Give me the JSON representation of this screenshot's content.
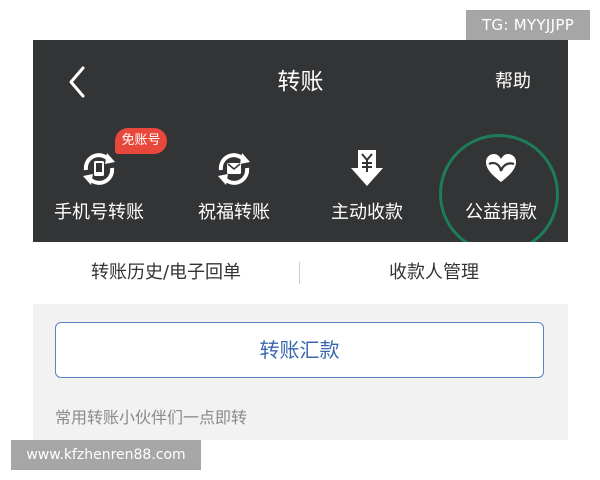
{
  "watermarks": {
    "top": "TG: MYYJJPP",
    "bottom": "www.kfzhenren88.com"
  },
  "header": {
    "title": "转账",
    "back_icon": "chevron-left-icon",
    "help_label": "帮助",
    "background_color": "#333436"
  },
  "actions": [
    {
      "label": "手机号转账",
      "icon": "phone-transfer-icon",
      "badge": "免账号"
    },
    {
      "label": "祝福转账",
      "icon": "blessing-transfer-icon"
    },
    {
      "label": "主动收款",
      "icon": "collect-payment-icon"
    },
    {
      "label": "公益捐款",
      "icon": "charity-donation-icon"
    }
  ],
  "subnav": {
    "history_label": "转账历史/电子回单",
    "payee_label": "收款人管理"
  },
  "transfer_button": {
    "label": "转账汇款",
    "accent_color": "#3a66b0"
  },
  "partners_hint": "常用转账小伙伴们一点即转",
  "highlight_color": "#1b7d5a",
  "badge_color": "#e8483c"
}
